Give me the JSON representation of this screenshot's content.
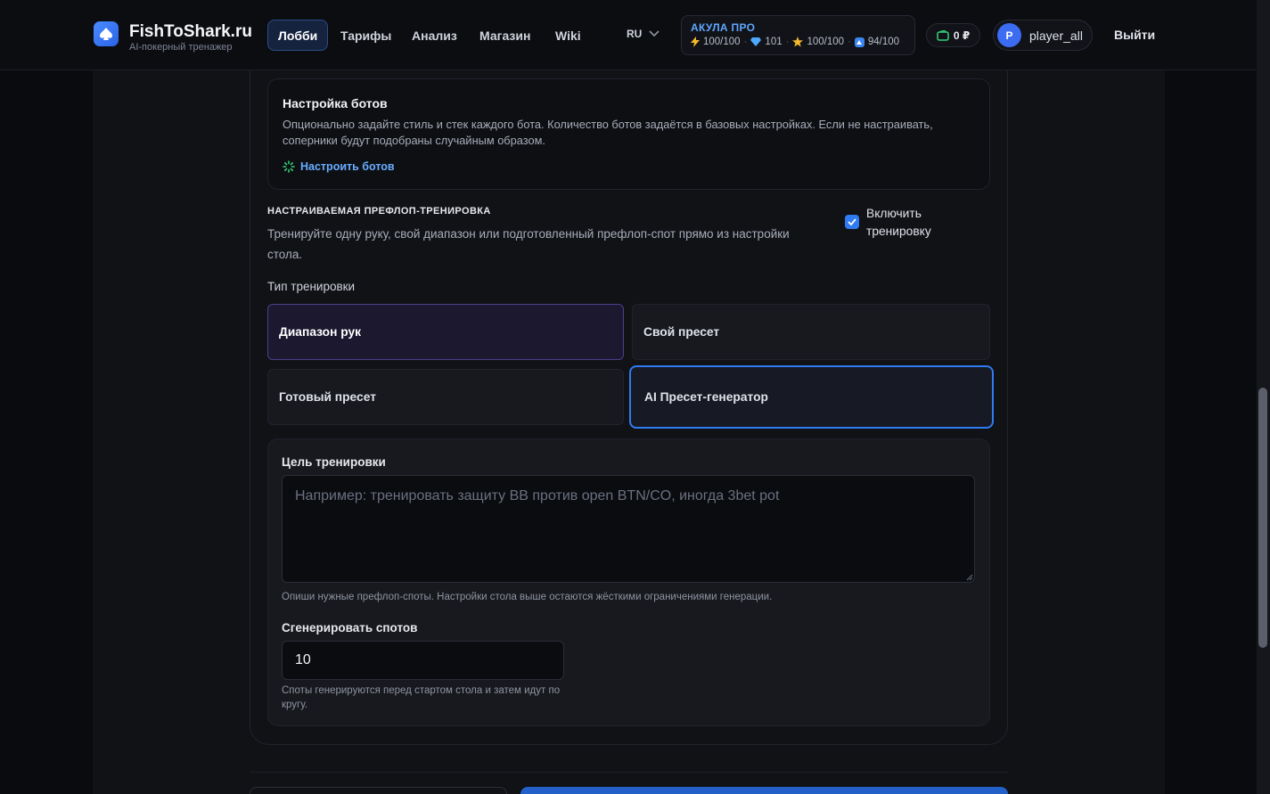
{
  "header": {
    "brand_name": "FishToShark.ru",
    "brand_sub": "AI-покерный тренажер",
    "nav": [
      {
        "label": "Лобби",
        "active": true
      },
      {
        "label": "Тарифы",
        "active": false
      },
      {
        "label": "Анализ",
        "active": false
      },
      {
        "label": "Магазин",
        "active": false
      },
      {
        "label": "Wiki",
        "active": false
      }
    ],
    "lang": "RU",
    "plan": {
      "title": "АКУЛА ПРО",
      "stat1": "100/100",
      "stat2": "101",
      "stat3": "100/100",
      "stat4": "94/100"
    },
    "wallet": "0 ₽",
    "user": {
      "avatar_letter": "P",
      "name": "player_all"
    },
    "logout": "Выйти"
  },
  "bots": {
    "title": "Настройка ботов",
    "desc": "Опционально задайте стиль и стек каждого бота. Количество ботов задаётся в базовых настройках. Если не настраивать, соперники будут подобраны случайным образом.",
    "link": "Настроить ботов"
  },
  "training": {
    "title": "НАСТРАИВАЕМАЯ ПРЕФЛОП-ТРЕНИРОВКА",
    "desc": "Тренируйте одну руку, свой диапазон или подготовленный префлоп-спот прямо из настройки стола.",
    "enable_label": "Включить тренировку",
    "enabled": true,
    "type_label": "Тип тренировки",
    "options": [
      {
        "label": "Диапазон рук"
      },
      {
        "label": "Свой пресет"
      },
      {
        "label": "Готовый пресет"
      },
      {
        "label": "AI Пресет-генератор"
      }
    ],
    "selected_option": "AI Пресет-генератор"
  },
  "generator": {
    "goal_label": "Цель тренировки",
    "goal_placeholder": "Например: тренировать защиту BB против open BTN/CO, иногда 3bet pot",
    "goal_hint": "Опиши нужные префлоп-споты. Настройки стола выше остаются жёсткими ограничениями генерации.",
    "count_label": "Сгенерировать спотов",
    "count_value": "10",
    "count_hint": "Споты генерируются перед стартом стола и затем идут по кругу."
  },
  "colors": {
    "accent": "#2f7bf1",
    "link": "#68adff",
    "selected_purple": "#4d3f8d"
  }
}
